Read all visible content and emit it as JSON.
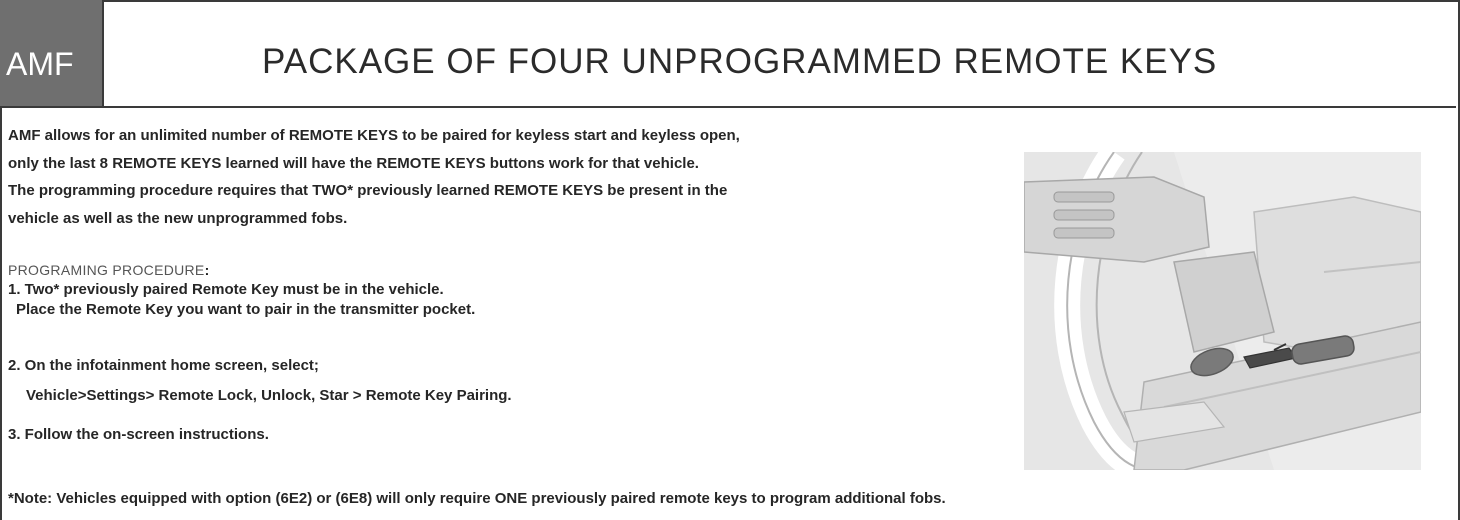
{
  "header": {
    "code": "AMF",
    "title": "PACKAGE OF FOUR UNPROGRAMMED REMOTE KEYS"
  },
  "intro": {
    "lines": [
      "AMF allows for an unlimited number of REMOTE KEYS to be paired for keyless start and keyless open,",
      "only the last 8 REMOTE KEYS learned will have the REMOTE KEYS buttons work for that vehicle.",
      "The programming procedure requires that TWO* previously learned REMOTE KEYS be present in the",
      "vehicle as well as the new unprogrammed fobs."
    ]
  },
  "procedure": {
    "heading": "PROGRAMING PROCEDURE",
    "heading_colon": ":",
    "steps": [
      {
        "line1": "1. Two* previously paired Remote Key must be in the vehicle.",
        "line2": "Place the Remote Key you want to pair in the transmitter pocket."
      },
      {
        "line1": "2. On the infotainment home screen, select;",
        "line2": "Vehicle>Settings> Remote Lock, Unlock, Star > Remote Key Pairing."
      },
      {
        "line1": "3. Follow the on-screen instructions."
      }
    ]
  },
  "note": "*Note: Vehicles equipped with option (6E2) or (6E8) will only require ONE previously paired remote keys to program additional fobs.",
  "colors": {
    "code_box": "#6f6f6f",
    "border": "#3a3a3a",
    "illustration_bg": "#e6e6e6"
  }
}
